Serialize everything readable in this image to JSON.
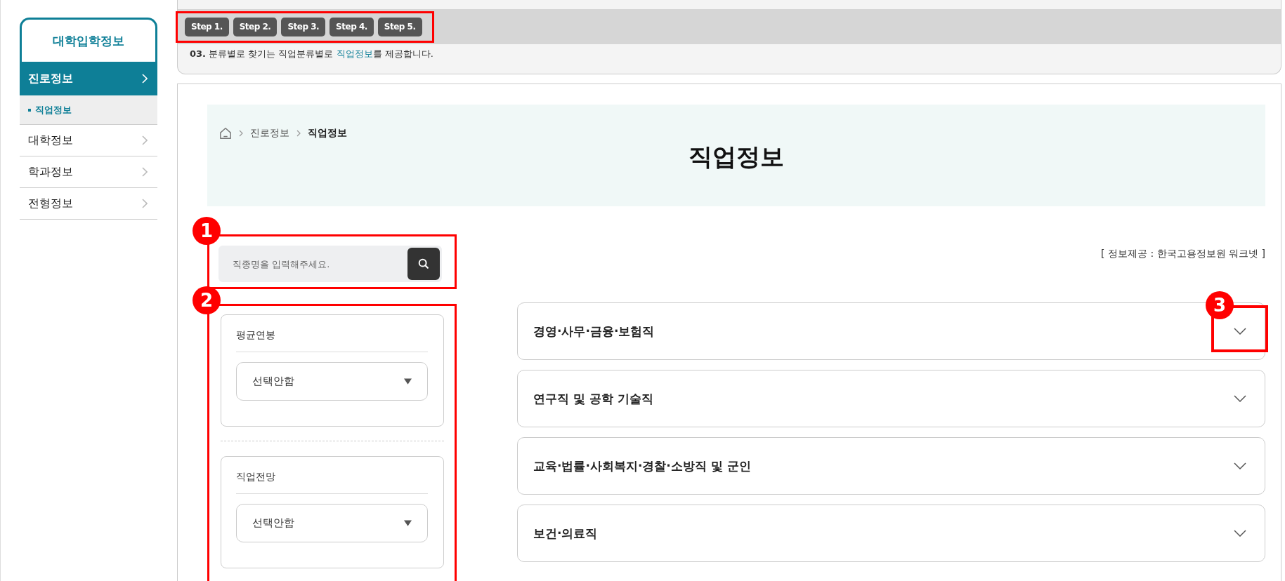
{
  "sidebar": {
    "title": "대학입학정보",
    "items": [
      {
        "label": "진로정보",
        "selected": true,
        "children": [
          {
            "label": "직업정보",
            "selected": true
          }
        ]
      },
      {
        "label": "대학정보",
        "selected": false
      },
      {
        "label": "학과정보",
        "selected": false
      },
      {
        "label": "전형정보",
        "selected": false
      }
    ]
  },
  "guide": {
    "steps_highlighted": true,
    "steps": [
      "Step 1.",
      "Step 2.",
      "Step 3.",
      "Step 4.",
      "Step 5."
    ],
    "note_number": "03.",
    "note_before": "분류별로 찾기는 직업분류별로 ",
    "note_highlight": "직업정보",
    "note_after": "를 제공합니다."
  },
  "breadcrumb": [
    "진로정보",
    "직업정보"
  ],
  "page_title": "직업정보",
  "search": {
    "callout": "1",
    "placeholder": "직종명을 입력해주세요."
  },
  "source_note": "[ 정보제공 : 한국고용정보원 워크넷 ]",
  "filters_callout": "2",
  "filters": [
    {
      "label": "평균연봉",
      "value": "선택안함"
    },
    {
      "label": "직업전망",
      "value": "선택안함"
    }
  ],
  "categories": [
    {
      "label": "경영·사무·금융·보험직",
      "expanded": false,
      "callout": "3"
    },
    {
      "label": "연구직 및 공학 기술직",
      "expanded": false
    },
    {
      "label": "교육·법률·사회복지·경찰·소방직 및 군인",
      "expanded": false
    },
    {
      "label": "보건·의료직",
      "expanded": false
    }
  ]
}
